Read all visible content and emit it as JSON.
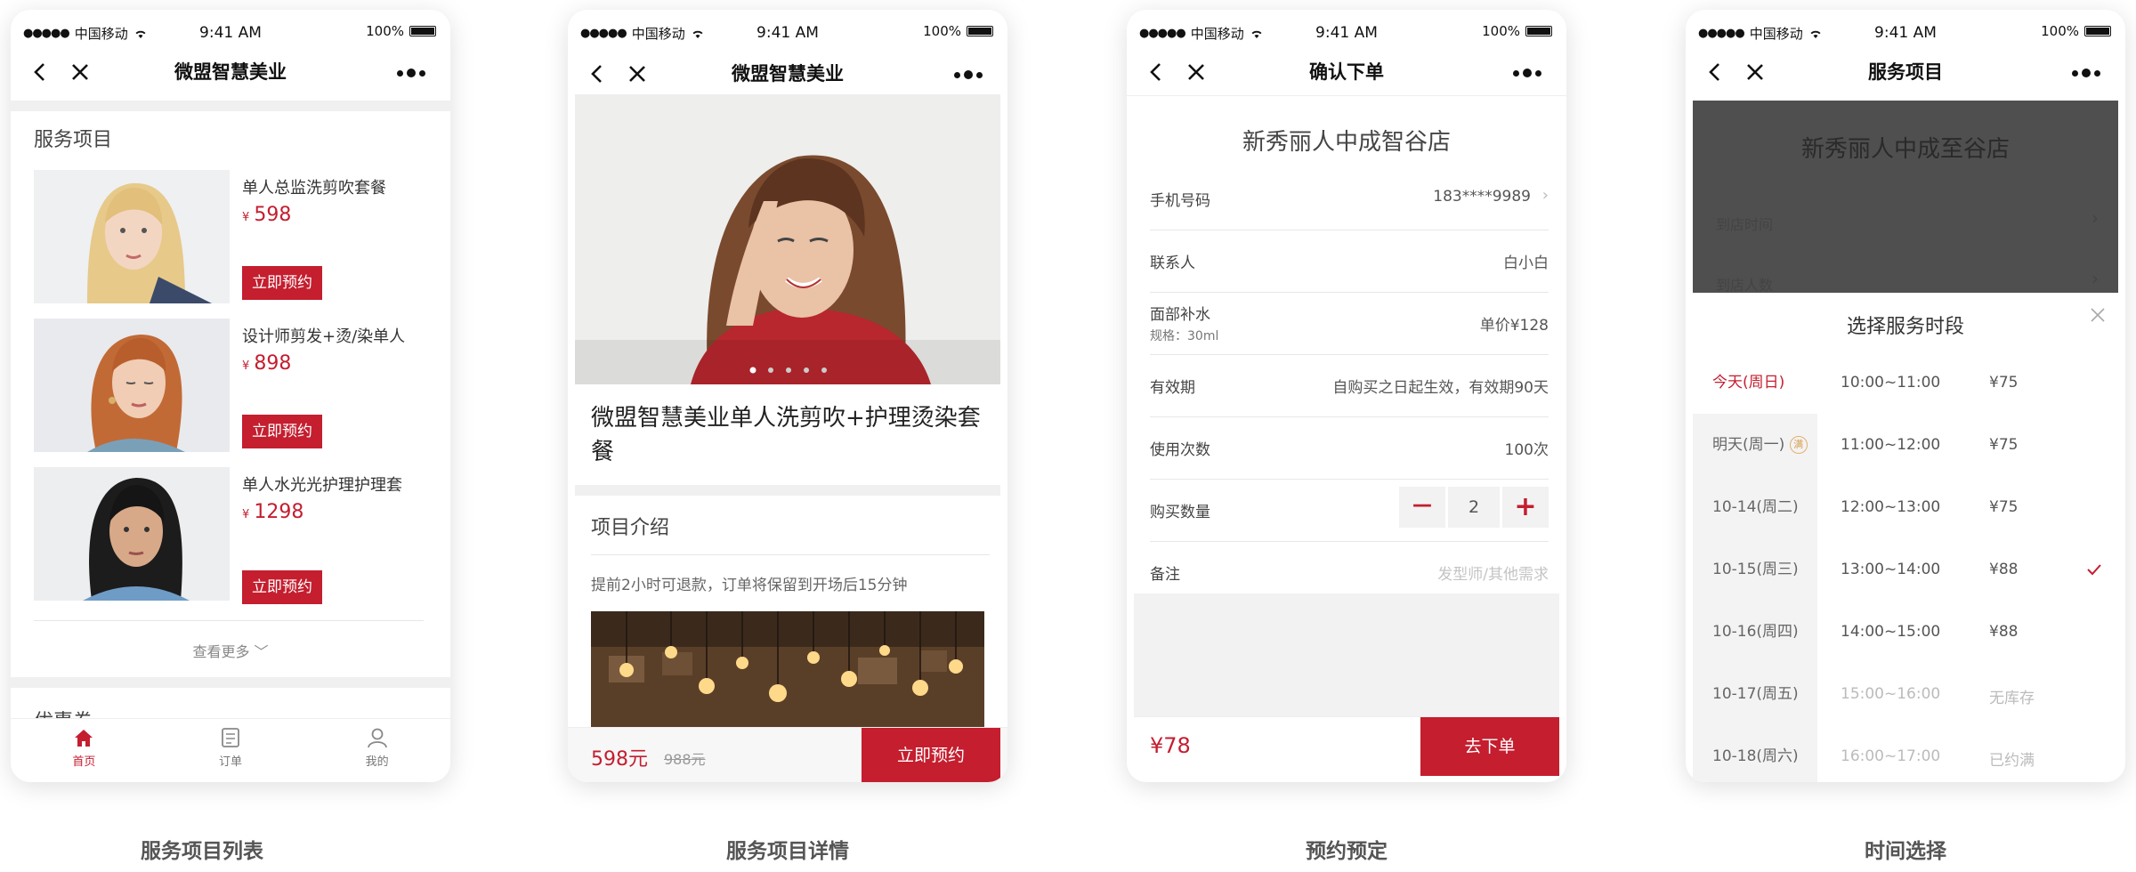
{
  "status": {
    "carrier": "中国移动",
    "time": "9:41 AM",
    "battery": "100%"
  },
  "screen1": {
    "nav_title": "微盟智慧美业",
    "section_title": "服务项目",
    "items": [
      {
        "name": "单人总监洗剪吹套餐",
        "currency": "¥",
        "price": "598",
        "button": "立即预约"
      },
      {
        "name": "设计师剪发+烫/染单人",
        "currency": "¥",
        "price": "898",
        "button": "立即预约"
      },
      {
        "name": "单人水光光护理护理套",
        "currency": "¥",
        "price": "1298",
        "button": "立即预约"
      }
    ],
    "more": "查看更多",
    "next_section": "优惠券",
    "tabs": [
      {
        "label": "首页",
        "icon": "home-icon"
      },
      {
        "label": "订单",
        "icon": "order-icon"
      },
      {
        "label": "我的",
        "icon": "user-icon"
      }
    ]
  },
  "screen2": {
    "nav_title": "微盟智慧美业",
    "product_title": "微盟智慧美业单人洗剪吹+护理烫染套餐",
    "intro_title": "项目介绍",
    "intro_text": "提前2小时可退款，订单将保留到开场后15分钟",
    "price": "598元",
    "original_price": "988元",
    "book_button": "立即预约"
  },
  "screen3": {
    "nav_title": "确认下单",
    "store": "新秀丽人中成智谷店",
    "phone_label": "手机号码",
    "phone_value": "183****9989",
    "contact_label": "联系人",
    "contact_value": "白小白",
    "item_label": "面部补水",
    "item_spec": "规格：30ml",
    "item_price": "单价¥128",
    "validity_label": "有效期",
    "validity_value": "自购买之日起生效，有效期90天",
    "uses_label": "使用次数",
    "uses_value": "100次",
    "qty_label": "购买数量",
    "qty_value": "2",
    "qty_minus": "－",
    "qty_plus": "+",
    "note_label": "备注",
    "note_placeholder": "发型师/其他需求",
    "total": "¥78",
    "submit": "去下单"
  },
  "screen4": {
    "nav_title": "服务项目",
    "store": "新秀丽人中成至谷店",
    "arrive_time": "到店时间",
    "arrive_people": "到店人数",
    "sheet_title": "选择服务时段",
    "full_badge": "满",
    "slots": [
      {
        "day": "今天(周日)",
        "time": "10:00~11:00",
        "price": "¥75"
      },
      {
        "day": "明天(周一)",
        "time": "11:00~12:00",
        "price": "¥75"
      },
      {
        "day": "10-14(周二)",
        "time": "12:00~13:00",
        "price": "¥75"
      },
      {
        "day": "10-15(周三)",
        "time": "13:00~14:00",
        "price": "¥88"
      },
      {
        "day": "10-16(周四)",
        "time": "14:00~15:00",
        "price": "¥88"
      },
      {
        "day": "10-17(周五)",
        "time": "15:00~16:00",
        "price": "无库存"
      },
      {
        "day": "10-18(周六)",
        "time": "16:00~17:00",
        "price": "已约满"
      }
    ]
  },
  "captions": [
    "服务项目列表",
    "服务项目详情",
    "预约预定",
    "时间选择"
  ],
  "colors": {
    "accent": "#c41e2f",
    "divider": "#f0f0f0"
  }
}
